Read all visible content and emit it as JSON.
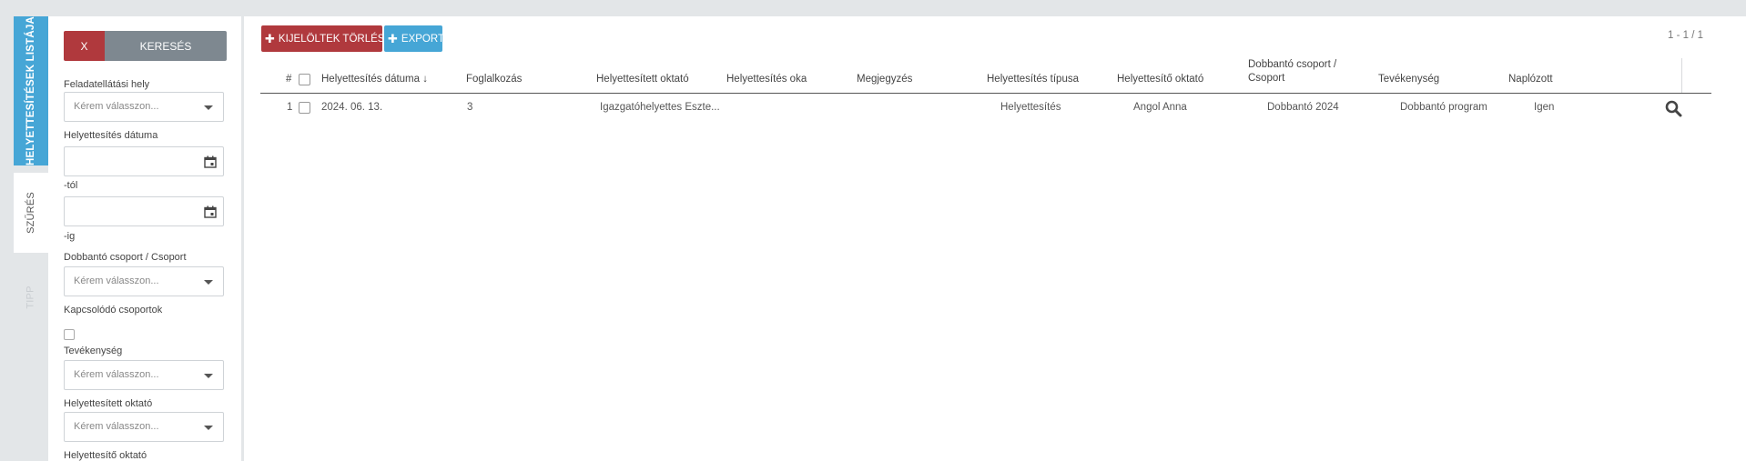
{
  "vtabs": {
    "list": "HELYETTESÍTÉSEK LISTÁJA",
    "filter": "SZŰRÉS",
    "tip": "TIPP"
  },
  "filter": {
    "clear_label": "X",
    "search_label": "KERESÉS",
    "fields": {
      "feladatellatasi_hely": {
        "label": "Feladatellátási hely",
        "placeholder": "Kérem válasszon..."
      },
      "helyettesites_datuma": {
        "label": "Helyettesítés dátuma"
      },
      "tol": {
        "label": "-tól"
      },
      "ig": {
        "label": "-ig"
      },
      "dobbanto_csoport": {
        "label": "Dobbantó csoport / Csoport",
        "placeholder": "Kérem válasszon..."
      },
      "kapcsolodo_csoportok": {
        "label": "Kapcsolódó csoportok"
      },
      "tevekenyseg": {
        "label": "Tevékenység",
        "placeholder": "Kérem válasszon..."
      },
      "helyettesitett_oktato": {
        "label": "Helyettesített oktató",
        "placeholder": "Kérem válasszon..."
      },
      "helyettesito_oktato": {
        "label": "Helyettesítő oktató"
      }
    }
  },
  "toolbar": {
    "delete_selected": "KIJELÖLTEK TÖRLÉSE",
    "export": "EXPORT",
    "pager": "1 - 1 / 1"
  },
  "table": {
    "headers": {
      "num": "#",
      "datum": "Helyettesítés dátuma",
      "sort_arrow": "↓",
      "foglalkozas": "Foglalkozás",
      "helyettesitett": "Helyettesített oktató",
      "oka": "Helyettesítés oka",
      "megjegyzes": "Megjegyzés",
      "tipus": "Helyettesítés típusa",
      "helyettesito": "Helyettesítő oktató",
      "dobbanto_line1": "Dobbantó csoport /",
      "dobbanto_line2": "Csoport",
      "tevekenyseg": "Tevékenység",
      "naplozott": "Naplózott"
    },
    "rows": [
      {
        "num": "1",
        "datum": "2024. 06. 13.",
        "foglalkozas": "3",
        "helyettesitett": "Igazgatóhelyettes Eszte...",
        "oka": "",
        "megjegyzes": "",
        "tipus": "Helyettesítés",
        "helyettesito": "Angol Anna",
        "dobbanto": "Dobbantó 2024",
        "tevekenyseg": "Dobbantó program",
        "naplozott": "Igen"
      }
    ]
  }
}
